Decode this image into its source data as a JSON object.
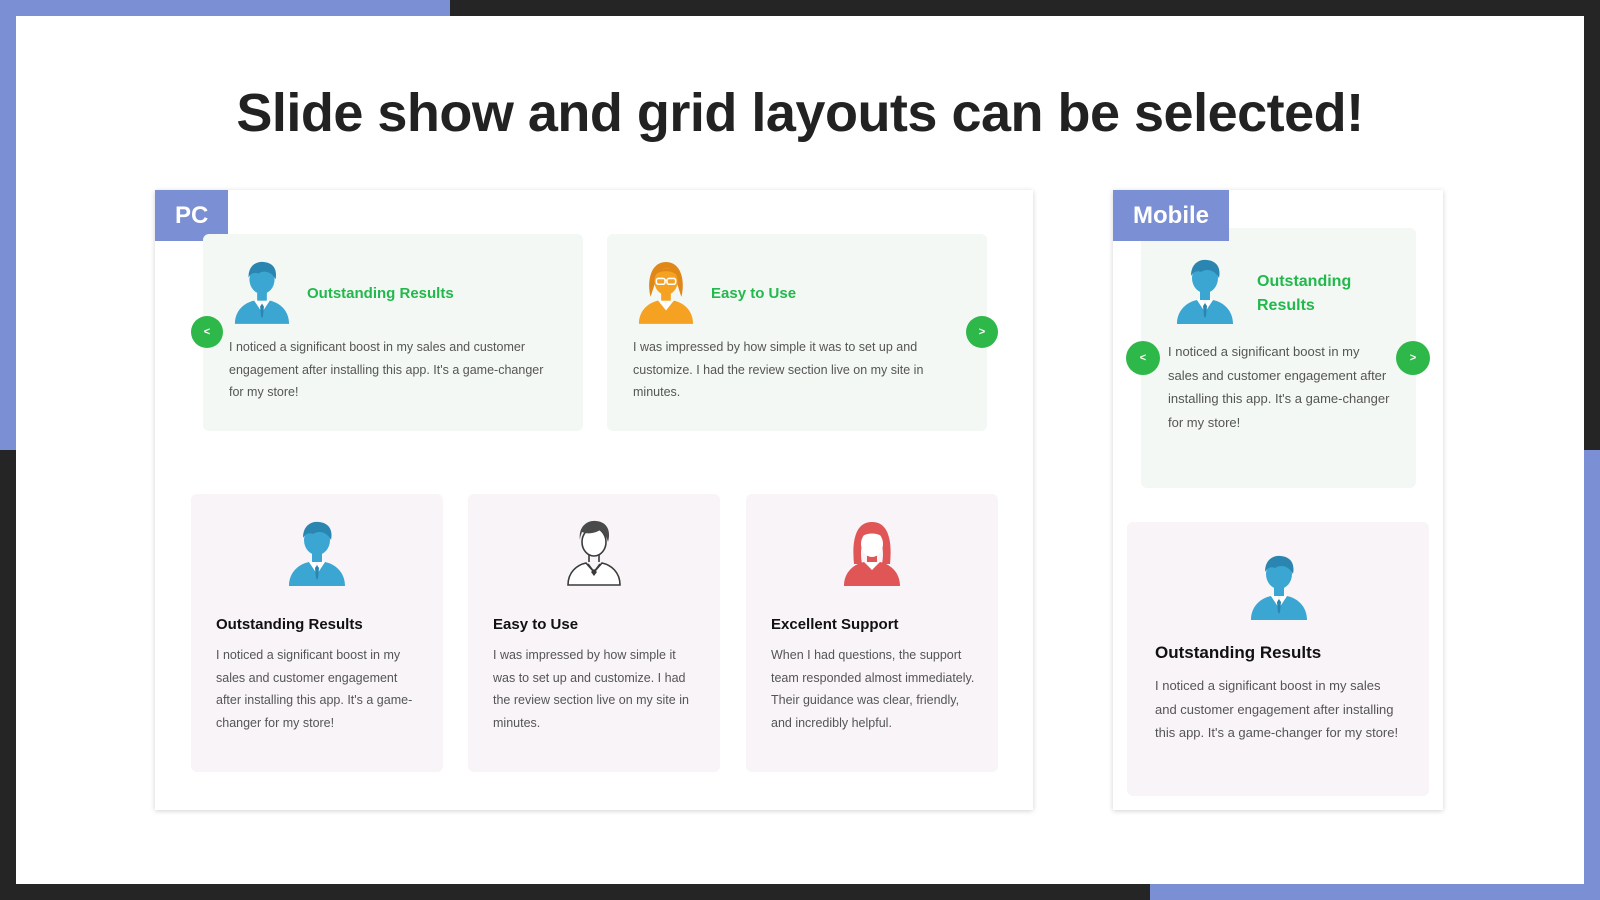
{
  "headline": "Slide show and grid layouts can be selected!",
  "colors": {
    "accent": "#7b8fd4",
    "green": "#2fb84a",
    "slide_bg": "#f3f8f4",
    "grid_bg": "#f8f4f8"
  },
  "pc": {
    "tag": "PC",
    "slides": [
      {
        "title": "Outstanding Results",
        "text": "I noticed a significant boost in my sales and customer engagement after installing this app. It's a game-changer for my store!",
        "icon": "man-blue-avatar-icon"
      },
      {
        "title": "Easy to Use",
        "text": "I was impressed by how simple it was to set up and customize. I had the review section live on my site in minutes.",
        "icon": "woman-orange-avatar-icon"
      }
    ],
    "prev_label": "<",
    "next_label": ">",
    "grid": [
      {
        "title": "Outstanding Results",
        "text": "I noticed a significant boost in my sales and customer engagement after installing this app. It's a game-changer for my store!",
        "icon": "man-blue-avatar-icon"
      },
      {
        "title": "Easy to Use",
        "text": "I was impressed by how simple it was to set up and customize. I had the review section live on my site in minutes.",
        "icon": "man-outline-avatar-icon"
      },
      {
        "title": "Excellent Support",
        "text": "When I had questions, the support team responded almost immediately. Their guidance was clear, friendly, and incredibly helpful.",
        "icon": "woman-red-avatar-icon"
      }
    ]
  },
  "mobile": {
    "tag": "Mobile",
    "slide": {
      "title": "Outstanding Results",
      "text": "I noticed a significant boost in my sales and customer engagement after installing this app. It's a game-changer for my store!",
      "icon": "man-blue-avatar-icon"
    },
    "prev_label": "<",
    "next_label": ">",
    "grid": {
      "title": "Outstanding Results",
      "text": "I noticed a significant boost in my sales and customer engagement after installing this app. It's a game-changer for my store!",
      "icon": "man-blue-avatar-icon"
    }
  }
}
